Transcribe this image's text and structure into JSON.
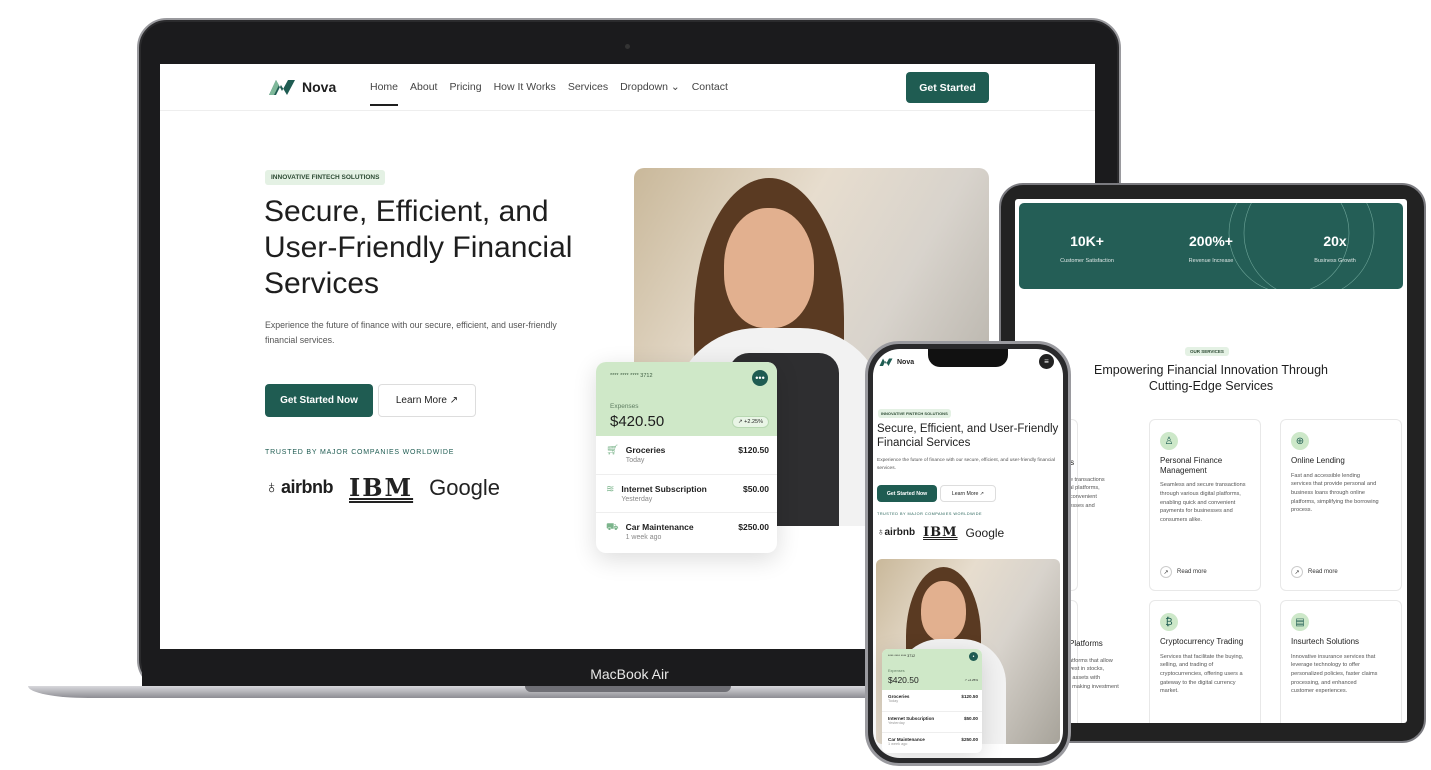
{
  "colors": {
    "accent": "#1f5c52",
    "badge_bg": "#e4f1e4",
    "card_green": "#cfe8c8",
    "stats_bg": "#245e56"
  },
  "laptop": {
    "label": "MacBook Air",
    "nav": {
      "brand": "Nova",
      "links": [
        "Home",
        "About",
        "Pricing",
        "How It Works",
        "Services",
        "Dropdown",
        "Contact"
      ],
      "cta": "Get Started"
    },
    "hero": {
      "badge": "INNOVATIVE FINTECH SOLUTIONS",
      "title_lines": [
        "Secure, Efficient, and",
        "User-Friendly Financial",
        "Services"
      ],
      "subtitle": "Experience the future of finance with our secure, efficient, and user-friendly financial services.",
      "primary_button": "Get Started Now",
      "secondary_button": "Learn More ↗",
      "trusted": "TRUSTED BY MAJOR COMPANIES WORLDWIDE",
      "logos": [
        "airbnb",
        "IBM",
        "Google"
      ]
    },
    "card": {
      "card_number": "**** **** **** 3712",
      "expenses_label": "Expenses",
      "amount": "$420.50",
      "change": "↗ +2.25%",
      "transactions": [
        {
          "icon": "cart-icon",
          "name": "Groceries",
          "when": "Today",
          "amount": "$120.50"
        },
        {
          "icon": "wifi-icon",
          "name": "Internet Subscription",
          "when": "Yesterday",
          "amount": "$50.00"
        },
        {
          "icon": "car-icon",
          "name": "Car Maintenance",
          "when": "1 week ago",
          "amount": "$250.00"
        }
      ]
    }
  },
  "tablet": {
    "stats": [
      {
        "value": "10K+",
        "label": "Customer Satisfaction"
      },
      {
        "value": "200%+",
        "label": "Revenue Increase"
      },
      {
        "value": "20x",
        "label": "Business Growth"
      }
    ],
    "section_badge": "OUR SERVICES",
    "section_title_lines": [
      "Empowering Financial Innovation Through",
      "Cutting-Edge Services"
    ],
    "services": [
      {
        "title": "ents",
        "desc": "ecure transactions\ndigital platforms,\nand convenient\nusinesses and",
        "read_more": "re"
      },
      {
        "title": "Personal Finance\nManagement",
        "desc": "Seamless and secure transactions\nthrough various digital platforms,\nenabling quick and convenient\npayments for businesses and\nconsumers alike.",
        "read_more": "Read more"
      },
      {
        "title": "Online Lending",
        "desc": "Fast and accessible lending\nservices that provide personal and\nbusiness loans through online\nplatforms, simplifying the borrowing\nprocess.",
        "read_more": "Read more"
      },
      {
        "title": "Platforms",
        "desc": "atforms that allow\nvest in stocks,\nr assets with\n, making investment\n.",
        "read_more": ""
      },
      {
        "title": "Cryptocurrency Trading",
        "desc": "Services that facilitate the buying,\nselling, and trading of\ncryptocurrencies, offering users a\ngateway to the digital currency\nmarket.",
        "read_more": ""
      },
      {
        "title": "Insurtech Solutions",
        "desc": "Innovative insurance services that\nleverage technology to offer\npersonalized policies, faster claims\nprocessing, and enhanced\ncustomer experiences.",
        "read_more": ""
      }
    ]
  },
  "phone": {
    "brand": "Nova",
    "badge": "INNOVATIVE FINTECH SOLUTIONS",
    "title": "Secure, Efficient, and User-Friendly Financial Services",
    "subtitle": "Experience the future of finance with our secure, efficient, and user-friendly financial services.",
    "primary_button": "Get Started Now",
    "secondary_button": "Learn More ↗",
    "trusted": "TRUSTED BY MAJOR COMPANIES WORLDWIDE",
    "logos": [
      "airbnb",
      "IBM",
      "Google"
    ],
    "card": {
      "card_number": "**** **** **** 3712",
      "expenses_label": "Expenses",
      "amount": "$420.50",
      "change": "↗ +2.25%",
      "transactions": [
        {
          "name": "Groceries",
          "when": "Today",
          "amount": "$120.50"
        },
        {
          "name": "Internet Subscription",
          "when": "Yesterday",
          "amount": "$50.00"
        },
        {
          "name": "Car Maintenance",
          "when": "1 week ago",
          "amount": "$250.00"
        }
      ]
    }
  }
}
